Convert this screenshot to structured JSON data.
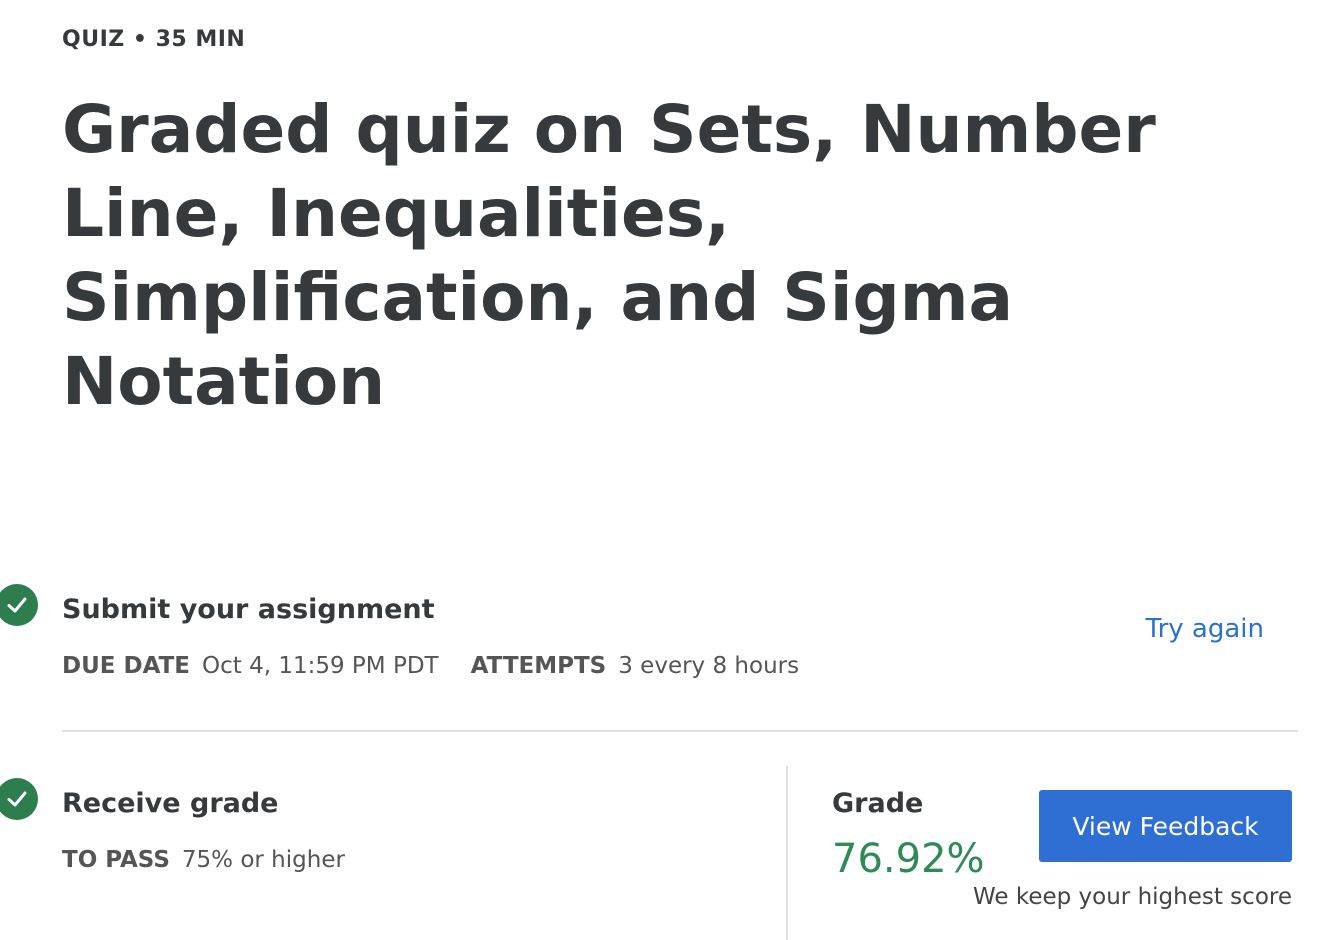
{
  "header": {
    "eyebrow": "QUIZ • 35 MIN",
    "title": "Graded quiz on Sets, Number Line, Inequalities, Simplification, and Sigma Notation"
  },
  "submit_step": {
    "icon": "check-circle-icon",
    "title": "Submit your assignment",
    "due_label": "DUE DATE",
    "due_value": "Oct 4, 11:59 PM PDT",
    "attempts_label": "ATTEMPTS",
    "attempts_value": "3 every 8 hours",
    "action_label": "Try again"
  },
  "grade_step": {
    "icon": "check-circle-icon",
    "title": "Receive grade",
    "pass_label": "TO PASS",
    "pass_value": "75% or higher",
    "grade_label": "Grade",
    "grade_value": "76.92%",
    "button_label": "View Feedback",
    "note": "We keep your highest score"
  },
  "colors": {
    "accent": "#2f6ed3",
    "link": "#2a73cc",
    "success": "#2e7d4f",
    "grade": "#2e8b57",
    "text": "#373a3c"
  }
}
